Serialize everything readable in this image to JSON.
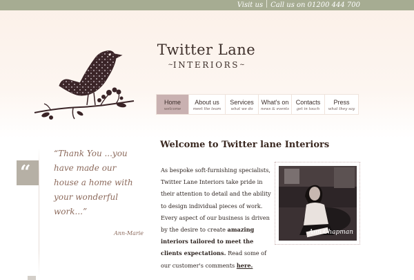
{
  "topbar": {
    "visit": "Visit us",
    "call": "Call us on 01200 444 700"
  },
  "logo": {
    "line1": "Twitter Lane",
    "line2": "INTERIORS",
    "dash_left": "~",
    "dash_right": "~"
  },
  "nav": {
    "items": [
      {
        "label": "Home",
        "sub": "welcome",
        "active": true
      },
      {
        "label": "About us",
        "sub": "meet the team"
      },
      {
        "label": "Services",
        "sub": "what we do"
      },
      {
        "label": "What's on",
        "sub": "news & events"
      },
      {
        "label": "Contacts",
        "sub": "get in touch"
      },
      {
        "label": "Press",
        "sub": "what they say"
      }
    ]
  },
  "quote": {
    "mark": "“",
    "text": "“Thank You ...you have made our house a home with your wonderful work...”",
    "attribution": "Ann-Marie"
  },
  "main": {
    "heading": "Welcome to Twitter lane Interiors",
    "p1": "As bespoke soft-furnishing specialists, Twitter Lane Interiors take pride in their attention to detail and the ability to design individual pieces of work. Every aspect of our business is driven by the desire to create ",
    "p_bold": "amazing interiors tailored to meet the clients expectations.",
    "p2": " Read some of our customer's comments ",
    "link": "here."
  },
  "photo": {
    "signature": "Ann Chapman"
  },
  "colors": {
    "topbar": "#a6ac92",
    "nav_active": "#c9b1b1",
    "bird_dark": "#3a2427",
    "quote_text": "#8c6a5c"
  }
}
